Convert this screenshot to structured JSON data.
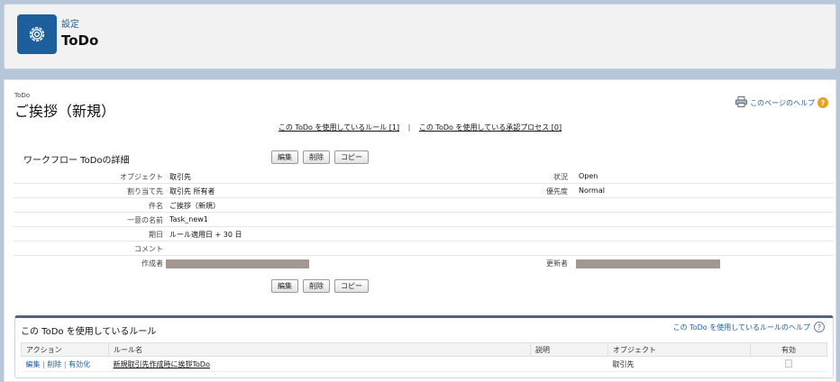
{
  "header": {
    "kicker": "設定",
    "title": "ToDo",
    "icon": "gear-icon"
  },
  "page": {
    "entity_type": "ToDo",
    "title": "ご挨拶（新規）",
    "help_link": "このページのヘルプ",
    "related_rules_link": "この ToDo を使用しているルール [1]",
    "related_approval_link": "この ToDo を使用している承認プロセス [0]"
  },
  "detail": {
    "section_title": "ワークフロー ToDoの詳細",
    "buttons": {
      "edit": "編集",
      "delete": "削除",
      "copy": "コピー"
    },
    "fields": {
      "object_label": "オブジェクト",
      "object_value": "取引先",
      "status_label": "状況",
      "status_value": "Open",
      "assignee_label": "割り当て先",
      "assignee_value": "取引先 所有者",
      "priority_label": "優先度",
      "priority_value": "Normal",
      "subject_label": "件名",
      "subject_value": "ご挨拶（新規）",
      "unique_name_label": "一意の名前",
      "unique_name_value": "Task_new1",
      "due_label": "期日",
      "due_value": "ルール適用日 + 30 日",
      "comment_label": "コメント",
      "comment_value": "",
      "created_by_label": "作成者",
      "modified_by_label": "更新者"
    }
  },
  "rules": {
    "title": "この ToDo を使用しているルール",
    "help_link": "この ToDo を使用しているルールのヘルプ",
    "columns": {
      "action": "アクション",
      "rule_name": "ルール名",
      "description": "説明",
      "object": "オブジェクト",
      "active": "有効"
    },
    "row": {
      "edit": "編集",
      "delete": "削除",
      "activate": "有効化",
      "rule_name": "新規取引先作成時に挨拶ToDo",
      "description": "",
      "object": "取引先"
    }
  },
  "colors": {
    "brand": "#1d5f9c",
    "background": "#b7c6d8",
    "redaction": "#a39792",
    "help_icon": "#e8a21a"
  }
}
